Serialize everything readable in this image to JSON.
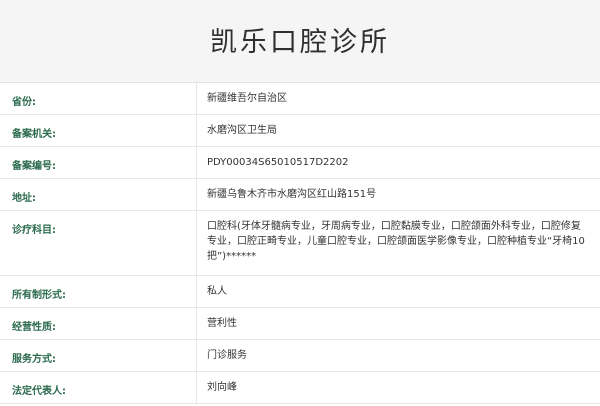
{
  "header": {
    "title": "凯乐口腔诊所"
  },
  "info": {
    "rows": [
      {
        "label": "省份:",
        "value": "新疆维吾尔自治区"
      },
      {
        "label": "备案机关:",
        "value": "水磨沟区卫生局"
      },
      {
        "label": "备案编号:",
        "value": "PDY00034S65010517D2202"
      },
      {
        "label": "地址:",
        "value": "新疆乌鲁木齐市水磨沟区红山路151号"
      },
      {
        "label": "诊疗科目:",
        "value": "口腔科(牙体牙髓病专业，牙周病专业，口腔黏膜专业，口腔颌面外科专业，口腔修复专业，口腔正畸专业，儿童口腔专业，口腔颌面医学影像专业，口腔种植专业“牙椅10把”)******"
      },
      {
        "label": "所有制形式:",
        "value": "私人"
      },
      {
        "label": "经营性质:",
        "value": "营利性"
      },
      {
        "label": "服务方式:",
        "value": "门诊服务"
      },
      {
        "label": "法定代表人:",
        "value": "刘向峰"
      }
    ]
  }
}
